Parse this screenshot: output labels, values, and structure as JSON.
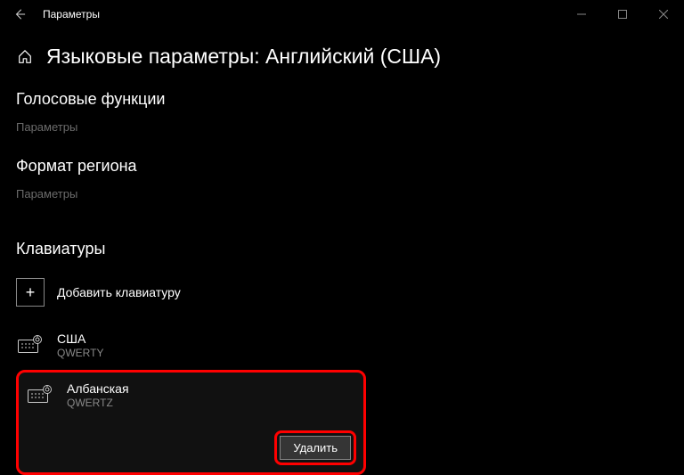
{
  "titlebar": {
    "title": "Параметры"
  },
  "page": {
    "title": "Языковые параметры: Английский (США)"
  },
  "voice": {
    "heading": "Голосовые функции",
    "link": "Параметры"
  },
  "region": {
    "heading": "Формат региона",
    "link": "Параметры"
  },
  "keyboards": {
    "heading": "Клавиатуры",
    "add_label": "Добавить клавиатуру",
    "items": [
      {
        "name": "США",
        "layout": "QWERTY"
      },
      {
        "name": "Албанская",
        "layout": "QWERTZ"
      }
    ],
    "delete_label": "Удалить"
  }
}
